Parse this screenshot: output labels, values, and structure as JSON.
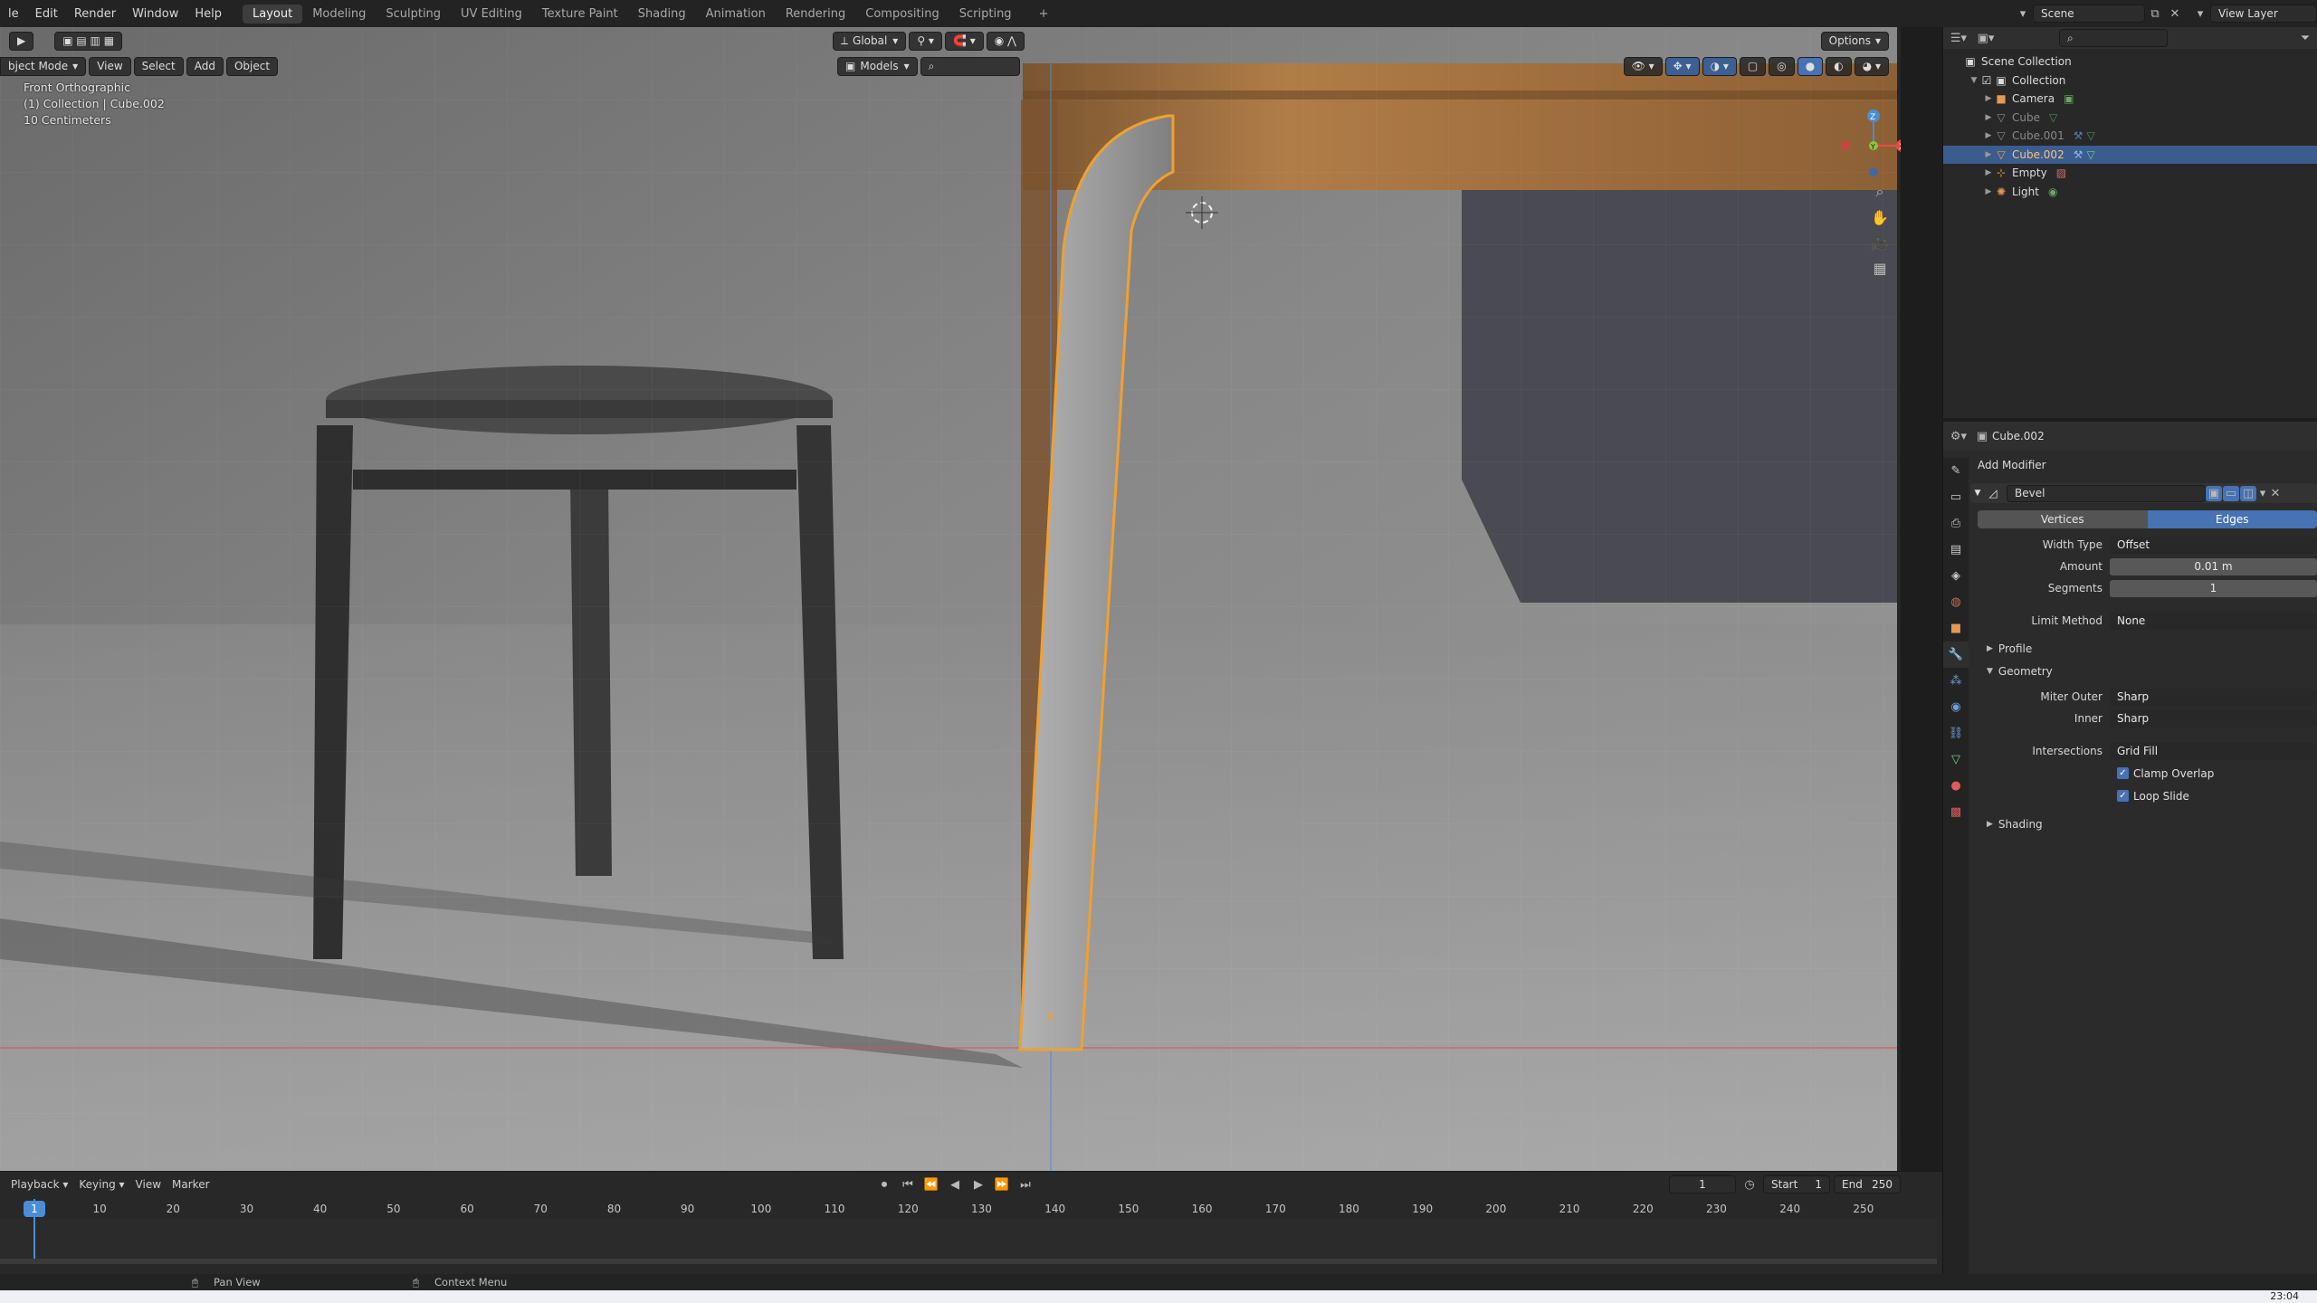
{
  "topbar": {
    "menus": [
      "le",
      "Edit",
      "Render",
      "Window",
      "Help"
    ],
    "workspaces": [
      "Layout",
      "Modeling",
      "Sculpting",
      "UV Editing",
      "Texture Paint",
      "Shading",
      "Animation",
      "Rendering",
      "Compositing",
      "Scripting"
    ],
    "active_workspace": "Layout",
    "scene_name": "Scene",
    "view_layer_name": "View Layer"
  },
  "viewport": {
    "orientation": "Global",
    "options_label": "Options",
    "mode": "bject Mode",
    "menus": [
      "View",
      "Select",
      "Add",
      "Object"
    ],
    "collection_filter": "Models",
    "info": {
      "view_name": "Front Orthographic",
      "object_path": "(1) Collection | Cube.002",
      "scale": "10 Centimeters"
    },
    "gizmo_axes": [
      "X",
      "Y",
      "Z"
    ]
  },
  "timeline": {
    "menus": [
      "Playback",
      "Keying",
      "View",
      "Marker"
    ],
    "current_frame": "1",
    "start_label": "Start",
    "start": "1",
    "end_label": "End",
    "end": "250",
    "cursor_label": "1",
    "ticks": [
      10,
      20,
      30,
      40,
      50,
      60,
      70,
      80,
      90,
      100,
      110,
      120,
      130,
      140,
      150,
      160,
      170,
      180,
      190,
      200,
      210,
      220,
      230,
      240,
      250
    ]
  },
  "statusbar": {
    "pan_view": "Pan View",
    "context_menu": "Context Menu",
    "clock": "23:04"
  },
  "outliner": {
    "root": "Scene Collection",
    "collection": "Collection",
    "items": [
      {
        "name": "Camera",
        "icon": "camera-icon",
        "dim": false,
        "selected": false
      },
      {
        "name": "Cube",
        "icon": "mesh-icon",
        "dim": true,
        "selected": false
      },
      {
        "name": "Cube.001",
        "icon": "mesh-icon",
        "dim": true,
        "selected": false
      },
      {
        "name": "Cube.002",
        "icon": "mesh-icon",
        "dim": false,
        "selected": true
      },
      {
        "name": "Empty",
        "icon": "empty-icon",
        "dim": false,
        "selected": false
      },
      {
        "name": "Light",
        "icon": "light-icon",
        "dim": false,
        "selected": false
      }
    ]
  },
  "properties": {
    "object_name": "Cube.002",
    "add_modifier": "Add Modifier",
    "modifier_name": "Bevel",
    "affect_tabs": [
      "Vertices",
      "Edges"
    ],
    "affect_active": "Edges",
    "width_type_label": "Width Type",
    "width_type": "Offset",
    "amount_label": "Amount",
    "amount": "0.01 m",
    "segments_label": "Segments",
    "segments": "1",
    "limit_method_label": "Limit Method",
    "limit_method": "None",
    "profile_label": "Profile",
    "geometry_label": "Geometry",
    "miter_outer_label": "Miter Outer",
    "miter_outer": "Sharp",
    "inner_label": "Inner",
    "inner": "Sharp",
    "intersections_label": "Intersections",
    "intersections": "Grid Fill",
    "clamp_overlap": "Clamp Overlap",
    "loop_slide": "Loop Slide",
    "shading_label": "Shading"
  },
  "colors": {
    "accent": "#4772b3",
    "selection_outline": "#f0a030",
    "x_axis": "#e84a4a",
    "y_axis": "#8ac53f",
    "z_axis": "#4b8dd6"
  }
}
